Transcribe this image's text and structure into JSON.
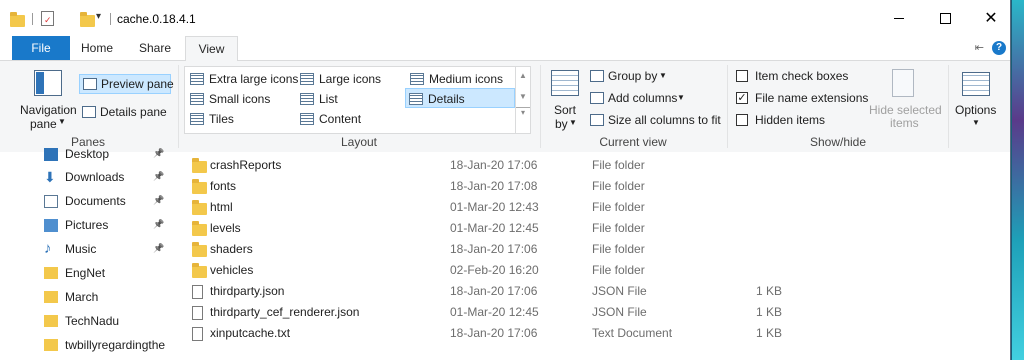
{
  "window": {
    "title": "cache.0.18.4.1"
  },
  "tabs": [
    "File",
    "Home",
    "Share",
    "View"
  ],
  "ribbon": {
    "panes": {
      "navigation_pane": "Navigation",
      "navigation_pane2": "pane",
      "preview_pane": "Preview pane",
      "details_pane": "Details pane",
      "label": "Panes"
    },
    "layout": {
      "items": [
        "Extra large icons",
        "Large icons",
        "Medium icons",
        "Small icons",
        "List",
        "Details",
        "Tiles",
        "Content"
      ],
      "selected": "Details",
      "label": "Layout"
    },
    "current_view": {
      "sort_by": "Sort",
      "sort_by2": "by",
      "group_by": "Group by",
      "add_columns": "Add columns",
      "size_all_columns": "Size all columns to fit",
      "label": "Current view"
    },
    "show_hide": {
      "item_check_boxes": "Item check boxes",
      "file_name_extensions": "File name extensions",
      "hidden_items": "Hidden items",
      "item_check_boxes_checked": false,
      "file_name_extensions_checked": true,
      "hidden_items_checked": false,
      "hide_selected_items": "Hide selected",
      "hide_selected_items2": "items",
      "label": "Show/hide"
    },
    "options": "Options"
  },
  "nav": {
    "items": [
      {
        "label": "Desktop",
        "icon": "desktop-icon",
        "pinned": true
      },
      {
        "label": "Downloads",
        "icon": "download-icon",
        "pinned": true
      },
      {
        "label": "Documents",
        "icon": "documents-icon",
        "pinned": true
      },
      {
        "label": "Pictures",
        "icon": "pictures-icon",
        "pinned": true
      },
      {
        "label": "Music",
        "icon": "music-icon",
        "pinned": true
      },
      {
        "label": "EngNet",
        "icon": "folder-icon",
        "pinned": false
      },
      {
        "label": "March",
        "icon": "folder-icon",
        "pinned": false
      },
      {
        "label": "TechNadu",
        "icon": "folder-icon",
        "pinned": false
      },
      {
        "label": "twbillyregardingthe",
        "icon": "folder-icon",
        "pinned": false
      }
    ]
  },
  "files": [
    {
      "name": "crashReports",
      "date": "18-Jan-20 17:06",
      "type": "File folder",
      "size": "",
      "kind": "folder"
    },
    {
      "name": "fonts",
      "date": "18-Jan-20 17:08",
      "type": "File folder",
      "size": "",
      "kind": "folder"
    },
    {
      "name": "html",
      "date": "01-Mar-20 12:43",
      "type": "File folder",
      "size": "",
      "kind": "folder"
    },
    {
      "name": "levels",
      "date": "01-Mar-20 12:45",
      "type": "File folder",
      "size": "",
      "kind": "folder"
    },
    {
      "name": "shaders",
      "date": "18-Jan-20 17:06",
      "type": "File folder",
      "size": "",
      "kind": "folder"
    },
    {
      "name": "vehicles",
      "date": "02-Feb-20 16:20",
      "type": "File folder",
      "size": "",
      "kind": "folder"
    },
    {
      "name": "thirdparty.json",
      "date": "18-Jan-20 17:06",
      "type": "JSON File",
      "size": "1 KB",
      "kind": "file"
    },
    {
      "name": "thirdparty_cef_renderer.json",
      "date": "01-Mar-20 12:45",
      "type": "JSON File",
      "size": "1 KB",
      "kind": "file"
    },
    {
      "name": "xinputcache.txt",
      "date": "18-Jan-20 17:06",
      "type": "Text Document",
      "size": "1 KB",
      "kind": "file"
    }
  ]
}
